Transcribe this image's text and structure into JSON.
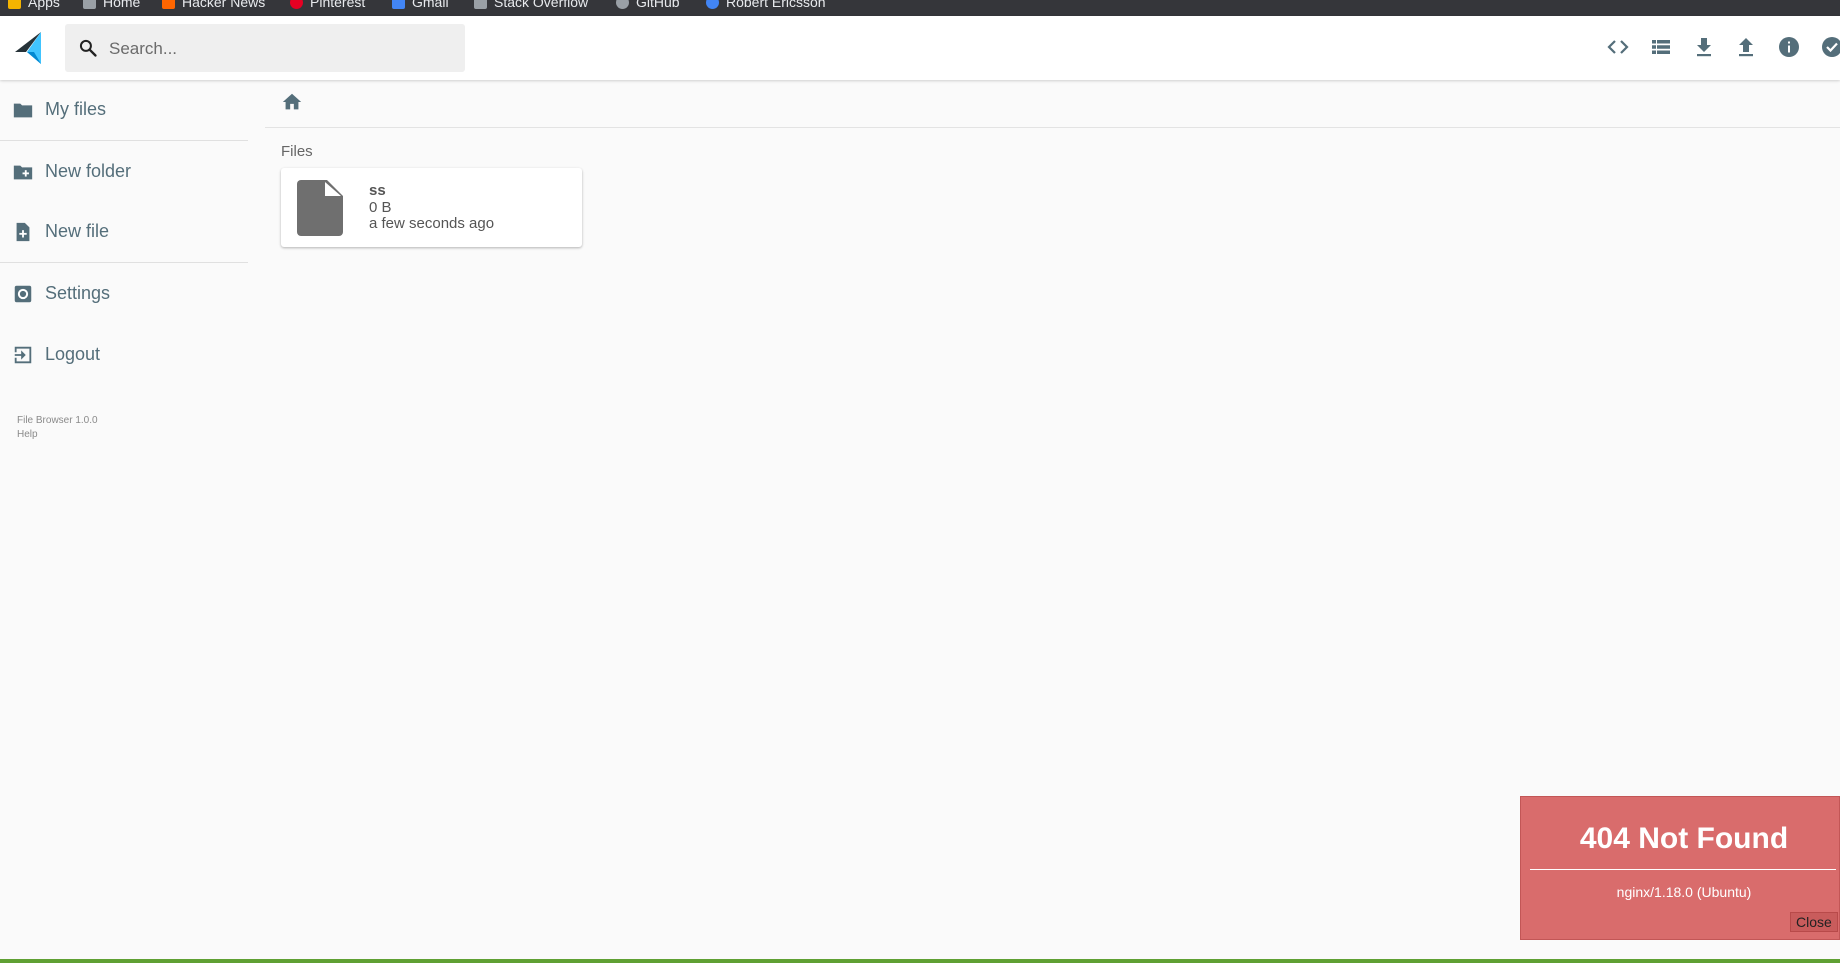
{
  "browser": {
    "bookmarks": [
      {
        "label": "Apps",
        "color": "#f4b400"
      },
      {
        "label": "Home",
        "color": "#9aa0a6"
      },
      {
        "label": "Hacker News",
        "color": "#ff6600"
      },
      {
        "label": "Pinterest",
        "color": "#e60023"
      },
      {
        "label": "Gmail",
        "color": "#4285f4"
      },
      {
        "label": "Stack Overflow",
        "color": "#9aa0a6"
      },
      {
        "label": "GitHub",
        "color": "#9aa0a6"
      },
      {
        "label": "Robert Ericsson",
        "color": "#4285f4"
      }
    ]
  },
  "header": {
    "search_placeholder": "Search...",
    "actions": [
      "code-view",
      "list-view",
      "download",
      "upload",
      "info",
      "select"
    ]
  },
  "sidebar": {
    "items": [
      {
        "label": "My files",
        "icon": "folder-icon"
      },
      {
        "label": "New folder",
        "icon": "create-new-folder-icon"
      },
      {
        "label": "New file",
        "icon": "note-add-icon"
      },
      {
        "label": "Settings",
        "icon": "settings-icon"
      },
      {
        "label": "Logout",
        "icon": "exit-icon"
      }
    ],
    "version": "File Browser 1.0.0",
    "help": "Help"
  },
  "main": {
    "section_title": "Files",
    "files": [
      {
        "name": "ss",
        "size": "0 B",
        "modified": "a few seconds ago"
      }
    ]
  },
  "error": {
    "title": "404 Not Found",
    "server": "nginx/1.18.0 (Ubuntu)",
    "close_label": "Close",
    "color": "#d96c6c"
  },
  "theme": {
    "accent": "#2979ff",
    "icon_color": "#546e7a"
  }
}
